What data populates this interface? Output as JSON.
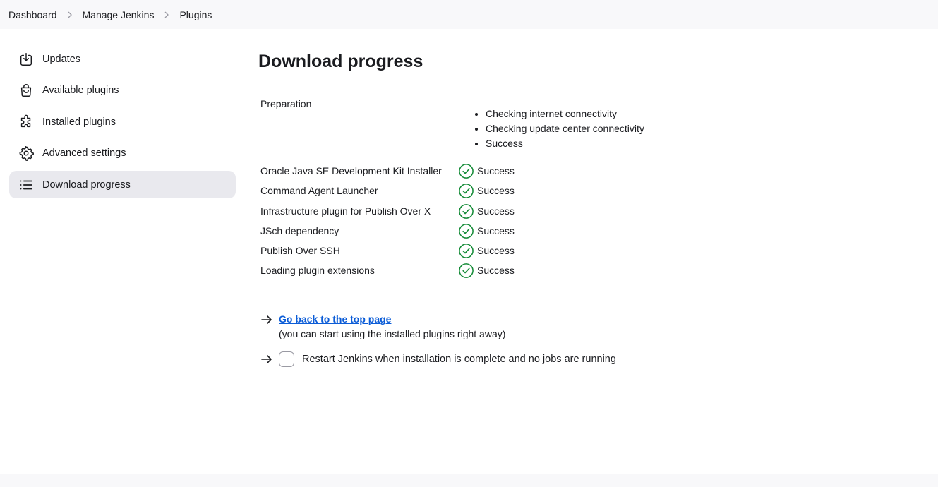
{
  "breadcrumbs": [
    "Dashboard",
    "Manage Jenkins",
    "Plugins"
  ],
  "sidebar": {
    "items": [
      {
        "label": "Updates",
        "icon": "download-icon"
      },
      {
        "label": "Available plugins",
        "icon": "shopping-bag-icon"
      },
      {
        "label": "Installed plugins",
        "icon": "puzzle-icon"
      },
      {
        "label": "Advanced settings",
        "icon": "gear-icon"
      },
      {
        "label": "Download progress",
        "icon": "list-icon",
        "active": true
      }
    ]
  },
  "main": {
    "title": "Download progress",
    "preparation": {
      "label": "Preparation",
      "steps": [
        "Checking internet connectivity",
        "Checking update center connectivity",
        "Success"
      ]
    },
    "plugins": [
      {
        "name": "Oracle Java SE Development Kit Installer",
        "status": "Success"
      },
      {
        "name": "Command Agent Launcher",
        "status": "Success"
      },
      {
        "name": "Infrastructure plugin for Publish Over X",
        "status": "Success"
      },
      {
        "name": "JSch dependency",
        "status": "Success"
      },
      {
        "name": "Publish Over SSH",
        "status": "Success"
      },
      {
        "name": "Loading plugin extensions",
        "status": "Success"
      }
    ],
    "go_back_link": "Go back to the top page",
    "go_back_hint": "(you can start using the installed plugins right away)",
    "restart_label": "Restart Jenkins when installation is complete and no jobs are running",
    "restart_checked": false
  },
  "colors": {
    "success": "#138a36",
    "link": "#0b5cd7",
    "active_bg": "#e9e9ee"
  }
}
